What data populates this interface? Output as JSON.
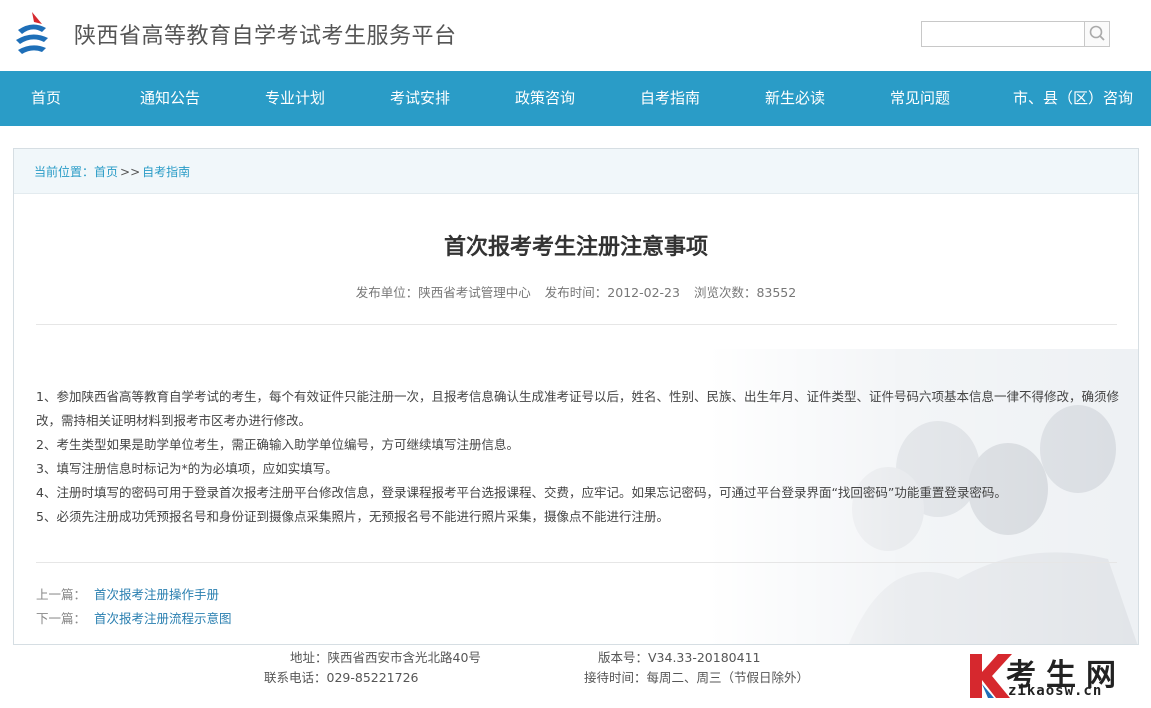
{
  "header": {
    "site_title": "陕西省高等教育自学考试考生服务平台",
    "search_placeholder": ""
  },
  "nav": {
    "items": [
      "首页",
      "通知公告",
      "专业计划",
      "考试安排",
      "政策咨询",
      "自考指南",
      "新生必读",
      "常见问题",
      "市、县（区）咨询"
    ]
  },
  "breadcrumb": {
    "prefix": "当前位置：",
    "home": "首页",
    "sep": ">>",
    "current": "自考指南"
  },
  "article": {
    "title": "首次报考考生注册注意事项",
    "publisher": "发布单位：陕西省考试管理中心",
    "date": "发布时间：2012-02-23",
    "views": "浏览次数：83552",
    "paragraphs": [
      "1、参加陕西省高等教育自学考试的考生，每个有效证件只能注册一次，且报考信息确认生成准考证号以后，姓名、性别、民族、出生年月、证件类型、证件号码六项基本信息一律不得修改，确须修改，需持相关证明材料到报考市区考办进行修改。",
      "2、考生类型如果是助学单位考生，需正确输入助学单位编号，方可继续填写注册信息。",
      "3、填写注册信息时标记为*的为必填项，应如实填写。",
      "4、注册时填写的密码可用于登录首次报考注册平台修改信息，登录课程报考平台选报课程、交费，应牢记。如果忘记密码，可通过平台登录界面“找回密码”功能重置登录密码。",
      "5、必须先注册成功凭预报名号和身份证到摄像点采集照片，无预报名号不能进行照片采集，摄像点不能进行注册。"
    ]
  },
  "prevnext": {
    "prev_label": "上一篇：",
    "prev_title": "首次报考注册操作手册",
    "next_label": "下一篇：",
    "next_title": "首次报考注册流程示意图"
  },
  "footer": {
    "address": "地址：陕西省西安市含光北路40号",
    "phone": "联系电话：029-85221726",
    "version": "版本号：V34.33-20180411",
    "reception": "接待时间：每周二、周三（节假日除外）"
  },
  "watermark": {
    "letter": "K",
    "chars": "考生网",
    "domain": "zikaosw.cn"
  },
  "colors": {
    "nav_bg": "#2a9cc7",
    "link": "#2a7fb0",
    "crumb_bg": "#f1f7fa",
    "watermark_red": "#d6282e"
  }
}
